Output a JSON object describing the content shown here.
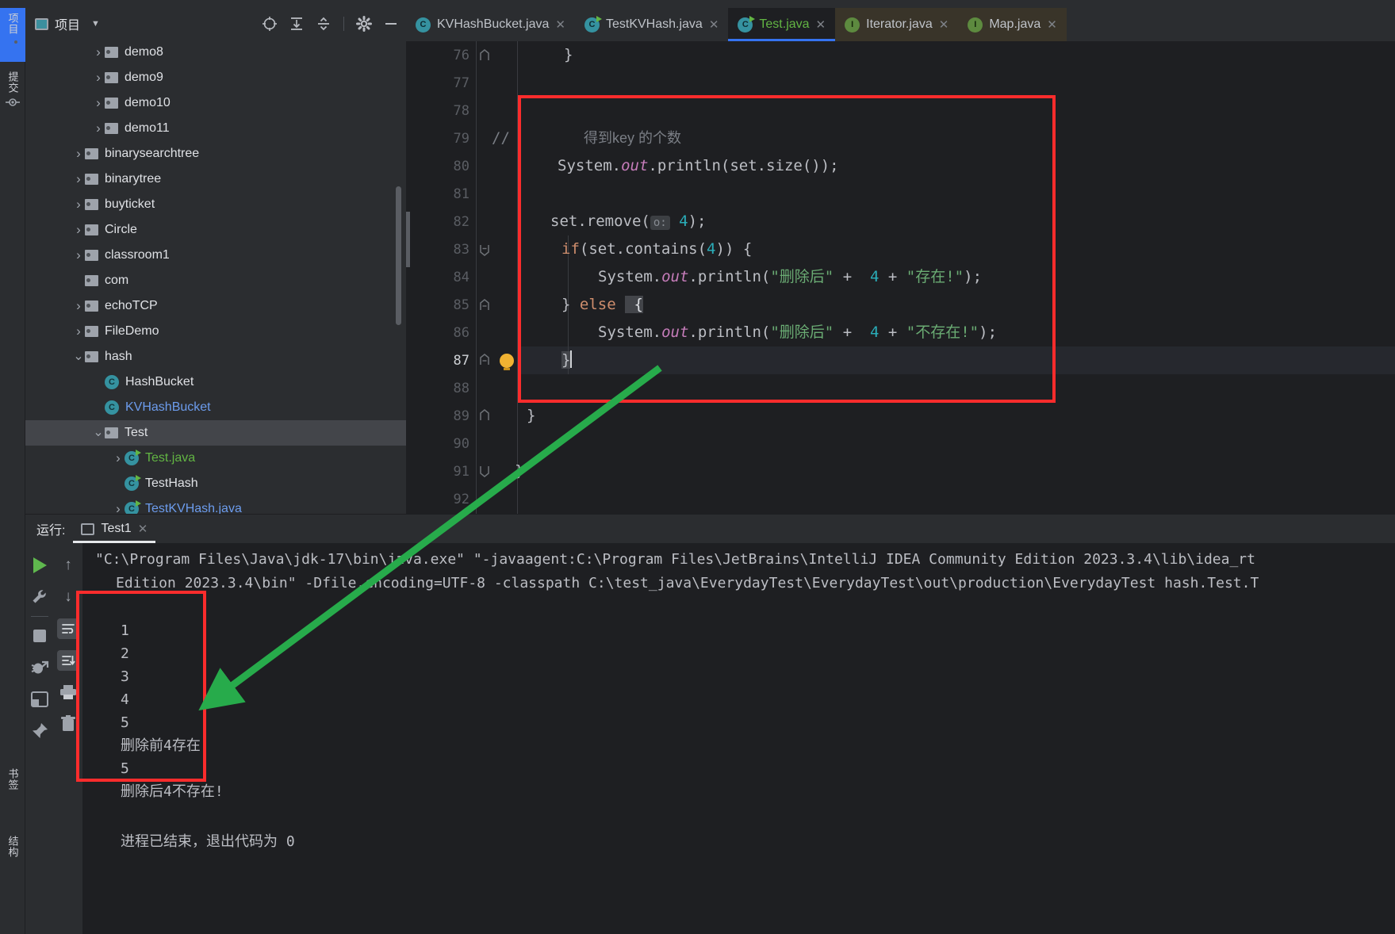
{
  "window": {
    "theme_bg": "#2b2d30",
    "editor_bg": "#1e1f22",
    "accent": "#3573f0",
    "annotation_color": "#fb2c2c",
    "arrow_color": "#27ab4b"
  },
  "rail": {
    "items": [
      {
        "label": "项目",
        "icon": "project-folder-icon",
        "selected": true
      },
      {
        "label": "提交",
        "icon": "commit-icon",
        "selected": false
      },
      {
        "label": "书签",
        "icon": "bookmark-icon",
        "selected": false
      },
      {
        "label": "结构",
        "icon": "structure-icon",
        "selected": false
      }
    ]
  },
  "project_panel": {
    "title": "项目",
    "dropdown_caret": "▼",
    "toolbar_icons": [
      "locate-target-icon",
      "expand-all-icon",
      "collapse-all-icon",
      "gear-icon",
      "minimize-icon"
    ],
    "tree": [
      {
        "label": "demo8",
        "type": "folder",
        "indent": 2,
        "arrow": "collapsed",
        "selected": false
      },
      {
        "label": "demo9",
        "type": "folder",
        "indent": 2,
        "arrow": "collapsed",
        "selected": false
      },
      {
        "label": "demo10",
        "type": "folder",
        "indent": 2,
        "arrow": "collapsed",
        "selected": false
      },
      {
        "label": "demo11",
        "type": "folder",
        "indent": 2,
        "arrow": "collapsed",
        "selected": false
      },
      {
        "label": "binarysearchtree",
        "type": "folder",
        "indent": 1,
        "arrow": "collapsed",
        "selected": false
      },
      {
        "label": "binarytree",
        "type": "folder",
        "indent": 1,
        "arrow": "collapsed",
        "selected": false
      },
      {
        "label": "buyticket",
        "type": "folder",
        "indent": 1,
        "arrow": "collapsed",
        "selected": false
      },
      {
        "label": "Circle",
        "type": "folder",
        "indent": 1,
        "arrow": "collapsed",
        "selected": false
      },
      {
        "label": "classroom1",
        "type": "folder",
        "indent": 1,
        "arrow": "collapsed",
        "selected": false
      },
      {
        "label": "com",
        "type": "folder",
        "indent": 1,
        "arrow": "none",
        "selected": false
      },
      {
        "label": "echoTCP",
        "type": "folder",
        "indent": 1,
        "arrow": "collapsed",
        "selected": false
      },
      {
        "label": "FileDemo",
        "type": "folder",
        "indent": 1,
        "arrow": "collapsed",
        "selected": false
      },
      {
        "label": "hash",
        "type": "folder",
        "indent": 1,
        "arrow": "expanded",
        "selected": false
      },
      {
        "label": "HashBucket",
        "type": "class",
        "indent": 2,
        "arrow": "none",
        "selected": false,
        "color": "plain"
      },
      {
        "label": "KVHashBucket",
        "type": "class",
        "indent": 2,
        "arrow": "none",
        "selected": false,
        "color": "blue"
      },
      {
        "label": "Test",
        "type": "folder",
        "indent": 2,
        "arrow": "expanded",
        "selected": true
      },
      {
        "label": "Test.java",
        "type": "class-runnable",
        "indent": 3,
        "arrow": "collapsed",
        "selected": false,
        "color": "green"
      },
      {
        "label": "TestHash",
        "type": "class-runnable",
        "indent": 3,
        "arrow": "none",
        "selected": false,
        "color": "plain"
      },
      {
        "label": "TestKVHash.java",
        "type": "class-runnable",
        "indent": 3,
        "arrow": "collapsed",
        "selected": false,
        "color": "blue"
      }
    ]
  },
  "editor": {
    "tabs": [
      {
        "label": "KVHashBucket.java",
        "icon": "class-icon",
        "active": false,
        "style": "normal"
      },
      {
        "label": "TestKVHash.java",
        "icon": "class-run-icon",
        "active": false,
        "style": "normal"
      },
      {
        "label": "Test.java",
        "icon": "class-run-icon",
        "active": true,
        "style": "normal"
      },
      {
        "label": "Iterator.java",
        "icon": "interface-icon",
        "active": false,
        "style": "dark"
      },
      {
        "label": "Map.java",
        "icon": "interface-icon",
        "active": false,
        "style": "dark"
      }
    ],
    "close_glyph": "✕",
    "line_numbers": [
      "76",
      "77",
      "78",
      "79",
      "80",
      "81",
      "82",
      "83",
      "84",
      "85",
      "86",
      "87",
      "88",
      "89",
      "90",
      "91",
      "92"
    ],
    "current_line": "87",
    "code": {
      "l76": "}",
      "l79_comment": "//",
      "l79_text": "得到key 的个数",
      "l80": "System.out.println(set.size());",
      "l82_a": "set.remove(",
      "l82_hint": "o:",
      "l82_num": "4",
      "l82_b": ");",
      "l83": "if(set.contains(4)) {",
      "l84_call": "System.out.println(",
      "l84_s1": "\"删除后\"",
      "l84_plus": "+",
      "l84_num": "4",
      "l84_s2": "\"存在!\"",
      "l84_end": ");",
      "l85": "} else  {",
      "l86_s2": "\"不存在!\"",
      "l87": "}",
      "l89": "}",
      "l91": "}"
    }
  },
  "run_panel": {
    "label": "运行:",
    "tab": "Test1",
    "close_glyph": "✕",
    "toolbar_left": [
      "run-icon",
      "wrench-icon",
      "stop-icon",
      "debug-rerun-icon",
      "layout-icon",
      "pin-icon"
    ],
    "toolbar_right": [
      "up-arrow-icon",
      "down-arrow-icon",
      "soft-wrap-icon",
      "scroll-to-end-icon",
      "print-icon",
      "trash-icon"
    ],
    "console": {
      "cmd_line1": "\"C:\\Program Files\\Java\\jdk-17\\bin\\java.exe\" \"-javaagent:C:\\Program Files\\JetBrains\\IntelliJ IDEA Community Edition 2023.3.4\\lib\\idea_rt",
      "cmd_line2": "Edition 2023.3.4\\bin\" -Dfile.encoding=UTF-8 -classpath C:\\test_java\\EverydayTest\\EverydayTest\\out\\production\\EverydayTest hash.Test.T",
      "output": [
        "1",
        "2",
        "3",
        "4",
        "5",
        "删除前4存在!",
        "5",
        "删除后4不存在!"
      ],
      "exit_message": "进程已结束，退出代码为 0"
    }
  },
  "annotations": {
    "code_box_name": "code-highlight-box",
    "console_box_name": "console-output-highlight-box",
    "arrow_name": "green-pointer-arrow"
  }
}
